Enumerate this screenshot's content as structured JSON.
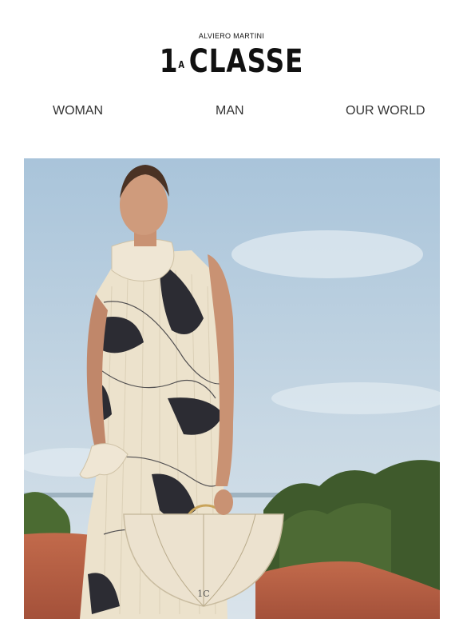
{
  "header": {
    "brand_top": "ALVIERO MARTINI",
    "logo_number": "1",
    "logo_sup": "A",
    "logo_word": "CLASSE"
  },
  "nav": {
    "items": [
      "WOMAN",
      "MAN",
      "OUR WORLD"
    ]
  },
  "hero": {
    "sky_color": "#bcd0df",
    "ground_color": "#b8634a",
    "tree_color": "#3f5a2c",
    "bag_color": "#ece2cf"
  }
}
